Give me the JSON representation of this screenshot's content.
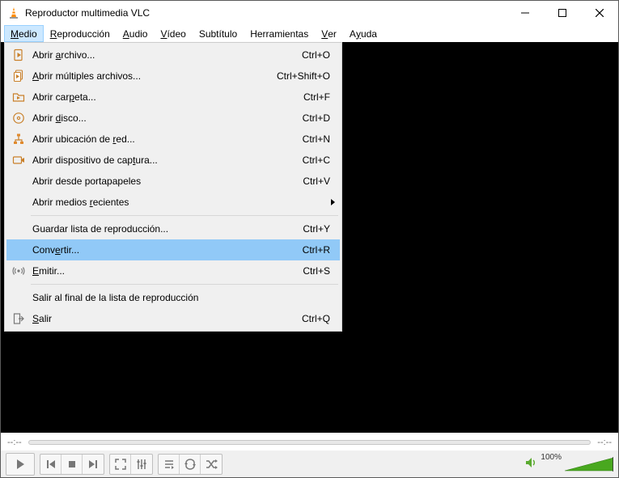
{
  "window": {
    "title": "Reproductor multimedia VLC"
  },
  "menubar": {
    "items": [
      {
        "label": "Medio",
        "ul": 0,
        "active": true
      },
      {
        "label": "Reproducción",
        "ul": 0
      },
      {
        "label": "Audio",
        "ul": 0
      },
      {
        "label": "Vídeo",
        "ul": 0
      },
      {
        "label": "Subtítulo",
        "ul": -1
      },
      {
        "label": "Herramientas",
        "ul": -1
      },
      {
        "label": "Ver",
        "ul": 0
      },
      {
        "label": "Ayuda",
        "ul": 1
      }
    ]
  },
  "dropdown": {
    "items": [
      {
        "type": "item",
        "icon": "file-play-icon",
        "label": "Abrir archivo...",
        "ul": 6,
        "shortcut": "Ctrl+O"
      },
      {
        "type": "item",
        "icon": "files-icon",
        "label": "Abrir múltiples archivos...",
        "ul": 0,
        "shortcut": "Ctrl+Shift+O"
      },
      {
        "type": "item",
        "icon": "folder-icon",
        "label": "Abrir carpeta...",
        "ul": 9,
        "shortcut": "Ctrl+F"
      },
      {
        "type": "item",
        "icon": "disc-icon",
        "label": "Abrir disco...",
        "ul": 6,
        "shortcut": "Ctrl+D"
      },
      {
        "type": "item",
        "icon": "network-icon",
        "label": "Abrir ubicación de red...",
        "ul": 19,
        "shortcut": "Ctrl+N"
      },
      {
        "type": "item",
        "icon": "capture-icon",
        "label": "Abrir dispositivo de captura...",
        "ul": 24,
        "shortcut": "Ctrl+C"
      },
      {
        "type": "item",
        "icon": "",
        "label": "Abrir desde portapapeles",
        "ul": -1,
        "shortcut": "Ctrl+V"
      },
      {
        "type": "item",
        "icon": "",
        "label": "Abrir medios recientes",
        "ul": 13,
        "submenu": true
      },
      {
        "type": "sep"
      },
      {
        "type": "item",
        "icon": "",
        "label": "Guardar lista de reproducción...",
        "ul": -1,
        "shortcut": "Ctrl+Y"
      },
      {
        "type": "item",
        "icon": "",
        "label": "Convertir...",
        "ul": 4,
        "shortcut": "Ctrl+R",
        "highlight": true
      },
      {
        "type": "item",
        "icon": "stream-icon",
        "label": "Emitir...",
        "ul": 0,
        "shortcut": "Ctrl+S"
      },
      {
        "type": "sep"
      },
      {
        "type": "item",
        "icon": "",
        "label": "Salir al final de la lista de reproducción",
        "ul": -1
      },
      {
        "type": "item",
        "icon": "exit-icon",
        "label": "Salir",
        "ul": 0,
        "shortcut": "Ctrl+Q"
      }
    ]
  },
  "seek": {
    "left_time": "--:--",
    "right_time": "--:--"
  },
  "controls": {
    "volume_pct": "100%"
  }
}
